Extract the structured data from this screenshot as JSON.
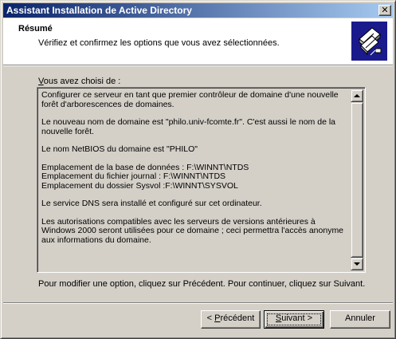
{
  "window": {
    "title": "Assistant Installation de Active Directory",
    "close_glyph": "✕"
  },
  "header": {
    "title": "Résumé",
    "subtitle": "Vérifiez et confirmez les options que vous avez sélectionnées.",
    "icon": "books-wizard-icon"
  },
  "summary": {
    "label_accel": "V",
    "label_rest": "ous avez choisi de :",
    "paragraphs": [
      "Configurer ce serveur en tant que premier contrôleur de domaine d'une nouvelle forêt d'arborescences de domaines.",
      "Le nouveau nom de domaine est \"philo.univ-fcomte.fr\". C'est aussi le nom de la nouvelle forêt.",
      "Le nom NetBIOS du domaine est \"PHILO\"",
      "Emplacement de la base de données : F:\\WINNT\\NTDS",
      "Emplacement du fichier journal : F:\\WINNT\\NTDS",
      "Emplacement du dossier Sysvol :F:\\WINNT\\SYSVOL",
      "Le service DNS sera installé et configuré sur cet ordinateur.",
      "Les autorisations compatibles avec les serveurs de versions antérieures à Windows 2000 seront utilisées pour ce domaine ; ceci permettra l'accès anonyme aux informations du domaine."
    ]
  },
  "instructions": "Pour modifier une option, cliquez sur Précédent. Pour continuer, cliquez sur Suivant.",
  "buttons": {
    "prev_prefix": "< ",
    "prev_accel": "P",
    "prev_rest": "récédent",
    "next_accel": "S",
    "next_rest": "uivant >",
    "cancel": "Annuler"
  }
}
